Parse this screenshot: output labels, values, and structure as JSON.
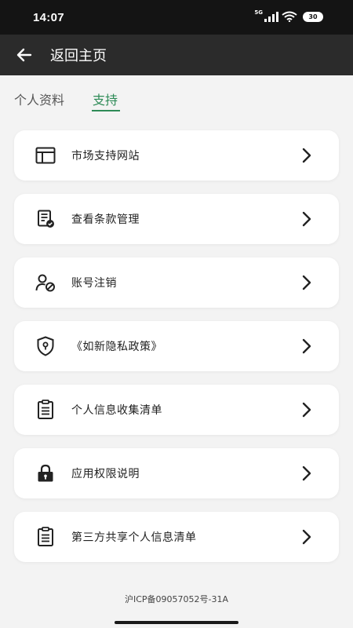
{
  "status_bar": {
    "time": "14:07",
    "network": "5G",
    "battery": "30"
  },
  "header": {
    "back_icon": "arrow-left-icon",
    "title": "返回主页"
  },
  "tabs": [
    {
      "label": "个人资料",
      "active": false
    },
    {
      "label": "支持",
      "active": true
    }
  ],
  "menu": [
    {
      "icon": "browser-window-icon",
      "label": "市场支持网站"
    },
    {
      "icon": "document-check-icon",
      "label": "查看条款管理"
    },
    {
      "icon": "user-block-icon",
      "label": "账号注销"
    },
    {
      "icon": "shield-lock-icon",
      "label": "《如新隐私政策》"
    },
    {
      "icon": "clipboard-list-icon",
      "label": "个人信息收集清单"
    },
    {
      "icon": "lock-icon",
      "label": "应用权限说明"
    },
    {
      "icon": "clipboard-list-icon",
      "label": "第三方共享个人信息清单"
    }
  ],
  "footer": {
    "icp": "沪ICP备09057052号-31A"
  },
  "colors": {
    "accent": "#2e8b57",
    "app_bar": "#2b2b2b",
    "status_bar": "#141414",
    "background": "#f3f3f3"
  }
}
